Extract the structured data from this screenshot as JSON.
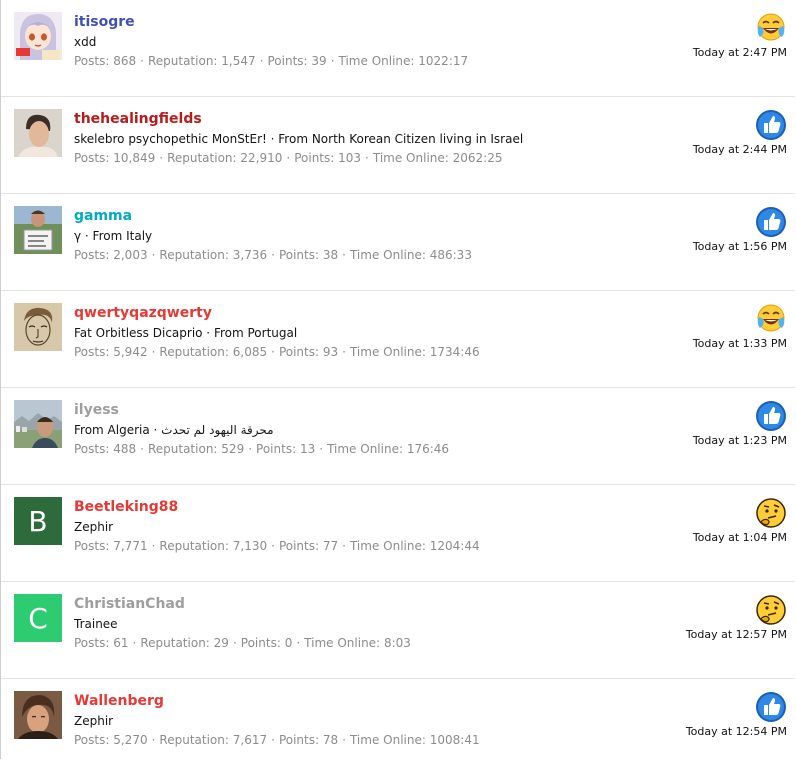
{
  "members": [
    {
      "username": "itisogre",
      "name_color": "#3f51b5",
      "title": "xdd",
      "stats": [
        {
          "label": "Posts:",
          "value": "868"
        },
        {
          "label": "Reputation:",
          "value": "1,547"
        },
        {
          "label": "Points:",
          "value": "39"
        },
        {
          "label": "Time Online:",
          "value": "1022:17"
        }
      ],
      "reaction": "laugh-cry-icon",
      "time": "Today at 2:47 PM",
      "avatar": "anime-girl"
    },
    {
      "username": "thehealingfields",
      "name_color": "#b71c1c",
      "title": "skelebro psychopethic MonStEr! · From North Korean Citizen living in Israel",
      "stats": [
        {
          "label": "Posts:",
          "value": "10,849"
        },
        {
          "label": "Reputation:",
          "value": "22,910"
        },
        {
          "label": "Points:",
          "value": "103"
        },
        {
          "label": "Time Online:",
          "value": "2062:25"
        }
      ],
      "reaction": "thumbs-up-icon",
      "time": "Today at 2:44 PM",
      "avatar": "photo-man"
    },
    {
      "username": "gamma",
      "name_color": "#00acc1",
      "title": "γ · From Italy",
      "stats": [
        {
          "label": "Posts:",
          "value": "2,003"
        },
        {
          "label": "Reputation:",
          "value": "3,736"
        },
        {
          "label": "Points:",
          "value": "38"
        },
        {
          "label": "Time Online:",
          "value": "486:33"
        }
      ],
      "reaction": "thumbs-up-icon",
      "time": "Today at 1:56 PM",
      "avatar": "photo-sign"
    },
    {
      "username": "qwertyqazqwerty",
      "name_color": "#e53935",
      "title": "Fat Orbitless Dicaprio · From Portugal",
      "stats": [
        {
          "label": "Posts:",
          "value": "5,942"
        },
        {
          "label": "Reputation:",
          "value": "6,085"
        },
        {
          "label": "Points:",
          "value": "93"
        },
        {
          "label": "Time Online:",
          "value": "1734:46"
        }
      ],
      "reaction": "laugh-cry-icon",
      "time": "Today at 1:33 PM",
      "avatar": "sketch-face"
    },
    {
      "username": "ilyess",
      "name_color": "#9e9e9e",
      "title": "From Algeria · محرقة اليهود لم تحدث",
      "stats": [
        {
          "label": "Posts:",
          "value": "488"
        },
        {
          "label": "Reputation:",
          "value": "529"
        },
        {
          "label": "Points:",
          "value": "13"
        },
        {
          "label": "Time Online:",
          "value": "176:46"
        }
      ],
      "reaction": "thumbs-up-icon",
      "time": "Today at 1:23 PM",
      "avatar": "photo-city"
    },
    {
      "username": "Beetleking88",
      "name_color": "#e53935",
      "title": "Zephir",
      "stats": [
        {
          "label": "Posts:",
          "value": "7,771"
        },
        {
          "label": "Reputation:",
          "value": "7,130"
        },
        {
          "label": "Points:",
          "value": "77"
        },
        {
          "label": "Time Online:",
          "value": "1204:44"
        }
      ],
      "reaction": "thinking-icon",
      "time": "Today at 1:04 PM",
      "avatar": "letter",
      "avatar_letter": "B",
      "avatar_color": "#2e6b3a"
    },
    {
      "username": "ChristianChad",
      "name_color": "#9e9e9e",
      "title": "Trainee",
      "stats": [
        {
          "label": "Posts:",
          "value": "61"
        },
        {
          "label": "Reputation:",
          "value": "29"
        },
        {
          "label": "Points:",
          "value": "0"
        },
        {
          "label": "Time Online:",
          "value": "8:03"
        }
      ],
      "reaction": "thinking-icon",
      "time": "Today at 12:57 PM",
      "avatar": "letter",
      "avatar_letter": "C",
      "avatar_color": "#2ecc71"
    },
    {
      "username": "Wallenberg",
      "name_color": "#e53935",
      "title": "Zephir",
      "stats": [
        {
          "label": "Posts:",
          "value": "5,270"
        },
        {
          "label": "Reputation:",
          "value": "7,617"
        },
        {
          "label": "Points:",
          "value": "78"
        },
        {
          "label": "Time Online:",
          "value": "1008:41"
        }
      ],
      "reaction": "thumbs-up-icon",
      "time": "Today at 12:54 PM",
      "avatar": "photo-portrait"
    }
  ]
}
